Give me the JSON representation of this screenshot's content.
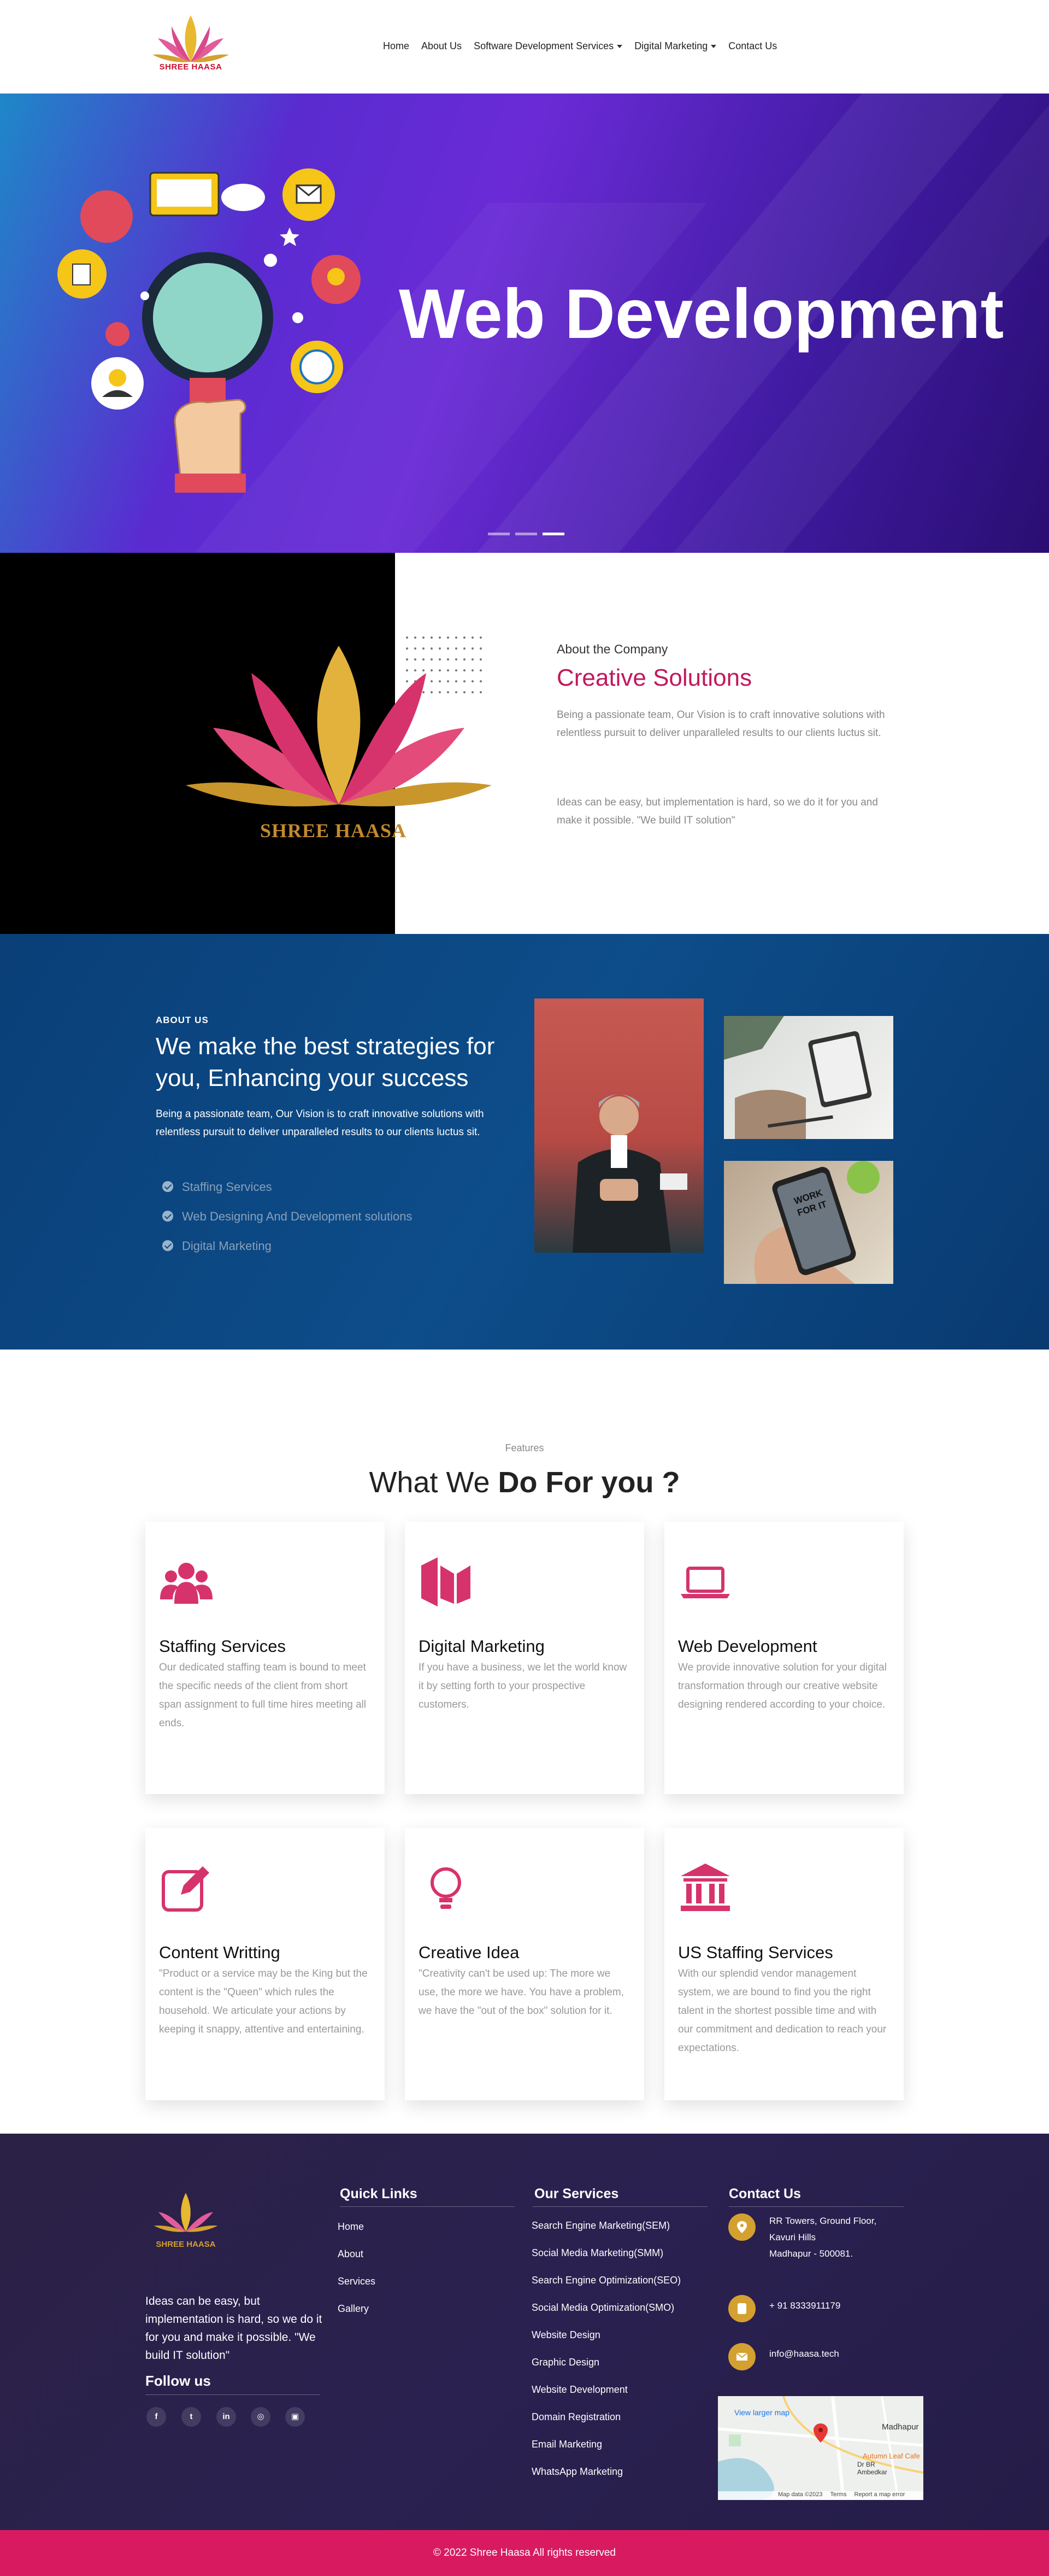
{
  "header": {
    "logo_text": "SHREE HAASA",
    "nav": [
      {
        "label": "Home"
      },
      {
        "label": "About Us"
      },
      {
        "label": "Software Development Services",
        "dropdown": true
      },
      {
        "label": "Digital Marketing",
        "dropdown": true
      },
      {
        "label": "Contact Us"
      }
    ]
  },
  "hero": {
    "title": "Web Development",
    "slides": 3,
    "active_slide": 3
  },
  "company": {
    "brand": "SHREE HAASA",
    "kicker": "About the Company",
    "title": "Creative Solutions",
    "p1": "Being a passionate team, Our Vision is to craft innovative solutions with relentless pursuit to deliver unparalleled results to our clients luctus sit.",
    "p2": "Ideas can be easy, but implementation is hard, so we do it for you and make it possible. \"We build IT solution\""
  },
  "strategies": {
    "kicker": "ABOUT US",
    "title": "We make the best strategies for you, Enhancing your success",
    "desc": "Being a passionate team, Our Vision is to craft innovative solutions with relentless pursuit to deliver unparalleled results to our clients luctus sit.",
    "items": [
      "Staffing Services",
      "Web Designing And Development solutions",
      "Digital Marketing"
    ],
    "phone_text": "WORK FOR IT"
  },
  "features": {
    "kicker": "Features",
    "title_light": "What We",
    "title_bold": "Do For you ?",
    "cards": [
      {
        "icon": "users-icon",
        "title": "Staffing Services",
        "text": "Our dedicated staffing team is bound to meet the specific needs of the client from short span assignment to full time hires meeting all ends."
      },
      {
        "icon": "megaphone-icon",
        "title": "Digital Marketing",
        "text": "If you have a business, we let the world know it by setting forth to your prospective customers."
      },
      {
        "icon": "laptop-icon",
        "title": "Web Development",
        "text": "We provide innovative solution for your digital transformation through our creative website designing rendered according to your choice."
      },
      {
        "icon": "edit-icon",
        "title": "Content Writting",
        "text": "\"Product or a service may be the King but the content is the \"Queen\" which rules the household. We articulate your actions by keeping it snappy, attentive and entertaining."
      },
      {
        "icon": "lightbulb-icon",
        "title": "Creative Idea",
        "text": "\"Creativity can't be used up: The more we use, the more we have. You have a problem, we have the \"out of the box\" solution for it."
      },
      {
        "icon": "bank-icon",
        "title": "US Staffing Services",
        "text": "With our splendid vendor management system, we are bound to find you the right talent in the shortest possible time and with our commitment and dedication to reach your expectations."
      }
    ]
  },
  "footer": {
    "brand": "SHREE HAASA",
    "tagline": "Ideas can be easy, but implementation is hard, so we do it for you and make it possible. \"We build IT solution\"",
    "follow": "Follow us",
    "social": [
      {
        "icon": "facebook-icon",
        "glyph": "f"
      },
      {
        "icon": "twitter-icon",
        "glyph": "t"
      },
      {
        "icon": "linkedin-icon",
        "glyph": "in"
      },
      {
        "icon": "instagram-icon",
        "glyph": "◎"
      },
      {
        "icon": "instagram-alt-icon",
        "glyph": "▣"
      }
    ],
    "quick_title": "Quick Links",
    "quick": [
      "Home",
      "About",
      "Services",
      "Gallery"
    ],
    "services_title": "Our Services",
    "services": [
      "Search Engine Marketing(SEM)",
      "Social Media Marketing(SMM)",
      "Search Engine Optimization(SEO)",
      "Social Media Optimization(SMO)",
      "Website Design",
      "Graphic Design",
      "Website Development",
      "Domain Registration",
      "Email Marketing",
      "WhatsApp Marketing"
    ],
    "contact_title": "Contact Us",
    "address": [
      "RR Towers, Ground Floor,",
      "Kavuri Hills",
      "Madhapur - 500081."
    ],
    "phone": "+ 91 8333911179",
    "email": "info@haasa.tech",
    "map": {
      "link": "View larger map",
      "label": "Madhapur",
      "data": "Map data ©2023",
      "terms": "Terms",
      "report": "Report a map error",
      "road": "Dr BR Ambedkar",
      "cafe": "Autumn Leaf Cafe"
    }
  },
  "copyright": "© 2022 Shree Haasa All rights reserved",
  "colors": {
    "accent": "#d81b60",
    "gold": "#d4a030",
    "navy": "#0d4d8a",
    "hero_purple": "#5a2bd0"
  }
}
